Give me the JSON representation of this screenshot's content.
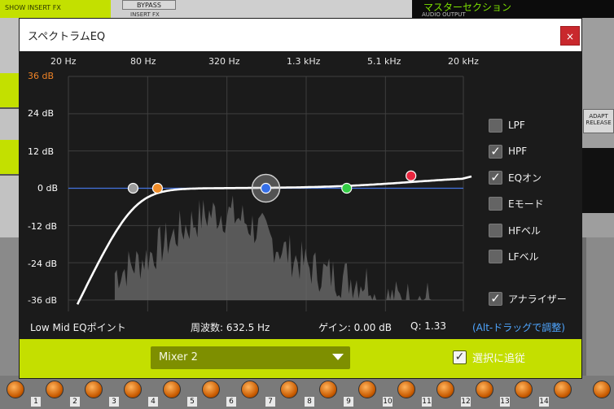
{
  "background": {
    "top_left_text": "SHOW INSERT FX",
    "bypass_label": "BYPASS",
    "insert_fx_label": "INSERT FX",
    "master_title": "マスターセクション",
    "master_sub": "AUDIO OUTPUT",
    "adapt_release": "ADAPT RELEASE",
    "channel_numbers": [
      "1",
      "2",
      "3",
      "4",
      "5",
      "6",
      "7",
      "8",
      "9",
      "10",
      "11",
      "12",
      "13",
      "14"
    ]
  },
  "dialog": {
    "title": "スペクトラムEQ",
    "close_label": "×"
  },
  "graph": {
    "freq_labels": [
      "20 Hz",
      "80 Hz",
      "320 Hz",
      "1.3 kHz",
      "5.1 kHz",
      "20 kHz"
    ],
    "db_labels": [
      "36 dB",
      "24 dB",
      "12 dB",
      "0 dB",
      "-12 dB",
      "-24 dB",
      "-36 dB"
    ],
    "db_range": [
      -36,
      36
    ],
    "points": [
      {
        "name": "hpf",
        "freq_hz": 62,
        "gain_db": 0,
        "color": "#9a9a9a"
      },
      {
        "name": "low",
        "freq_hz": 95,
        "gain_db": 0,
        "color": "#f08a24"
      },
      {
        "name": "low-mid",
        "freq_hz": 632.5,
        "gain_db": 0,
        "color": "#2f6be8",
        "selected": true
      },
      {
        "name": "high-mid",
        "freq_hz": 2600,
        "gain_db": 0,
        "color": "#2ecc40"
      },
      {
        "name": "high",
        "freq_hz": 8000,
        "gain_db": 4,
        "color": "#e8203a"
      }
    ]
  },
  "options": [
    {
      "label": "LPF",
      "checked": false
    },
    {
      "label": "HPF",
      "checked": true
    },
    {
      "label": "EQオン",
      "checked": true
    },
    {
      "label": "Eモード",
      "checked": false
    },
    {
      "label": "HFベル",
      "checked": false
    },
    {
      "label": "LFベル",
      "checked": false
    },
    {
      "label": "アナライザー",
      "checked": true
    }
  ],
  "info": {
    "point_name": "Low Mid EQポイント",
    "frequency": "周波数: 632.5 Hz",
    "gain": "ゲイン: 0.00 dB",
    "q": "Q: 1.33",
    "hint": "(Alt-ドラッグで調整)"
  },
  "footer": {
    "mixer_value": "Mixer 2",
    "follow_label": "選択に追従",
    "follow_checked": true
  },
  "colors": {
    "accent": "#c4df00",
    "select_bg": "#7e8f00",
    "close_red": "#c9282d",
    "hint_blue": "#4aa3ff"
  }
}
